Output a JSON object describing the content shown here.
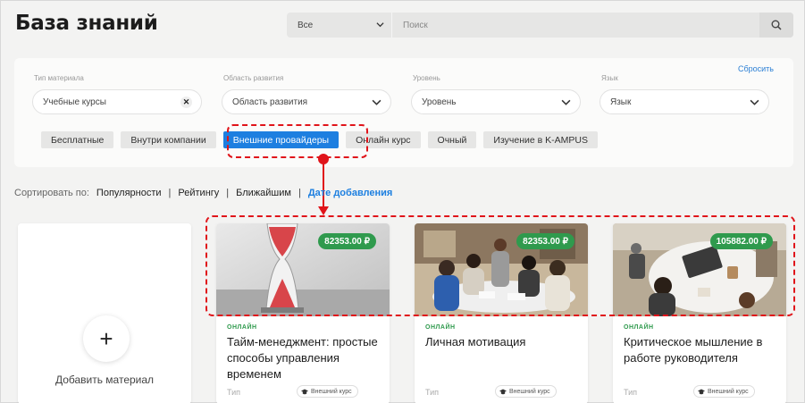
{
  "page": {
    "title": "База знаний"
  },
  "search": {
    "category": "Все",
    "placeholder": "Поиск"
  },
  "filters": {
    "reset": "Сбросить",
    "groups": [
      {
        "label": "Тип материала",
        "value": "Учебные курсы",
        "clearable": true
      },
      {
        "label": "Область развития",
        "value": "Область развития",
        "clearable": false
      },
      {
        "label": "Уровень",
        "value": "Уровень",
        "clearable": false
      },
      {
        "label": "Язык",
        "value": "Язык",
        "clearable": false
      }
    ],
    "chips": [
      {
        "label": "Бесплатные",
        "active": false
      },
      {
        "label": "Внутри компании",
        "active": false
      },
      {
        "label": "Внешние провайдеры",
        "active": true
      },
      {
        "label": "Онлайн курс",
        "active": false
      },
      {
        "label": "Очный",
        "active": false
      },
      {
        "label": "Изучение в K-AMPUS",
        "active": false
      }
    ]
  },
  "sort": {
    "label": "Сортировать по:",
    "options": [
      {
        "label": "Популярности",
        "active": false
      },
      {
        "label": "Рейтингу",
        "active": false
      },
      {
        "label": "Ближайшим",
        "active": false
      },
      {
        "label": "Дате добавления",
        "active": true
      }
    ],
    "separator": "|"
  },
  "add_card": {
    "icon": "+",
    "label": "Добавить материал"
  },
  "courses": [
    {
      "price": "82353.00 ₽",
      "format": "ОНЛАЙН",
      "title": "Тайм-менеджмент: простые способы управления временем",
      "meta": "Тип",
      "badge": "Внешний курс",
      "image": "hourglass"
    },
    {
      "price": "82353.00 ₽",
      "format": "ОНЛАЙН",
      "title": "Личная мотивация",
      "meta": "Тип",
      "badge": "Внешний курс",
      "image": "meeting"
    },
    {
      "price": "105882.00 ₽",
      "format": "ОНЛАЙН",
      "title": "Критическое мышление в работе руководителя",
      "meta": "Тип",
      "badge": "Внешний курс",
      "image": "desk"
    }
  ],
  "colors": {
    "accent": "#1d7fe0",
    "price_badge": "#2f9a4d",
    "annotation": "#e0141a"
  }
}
